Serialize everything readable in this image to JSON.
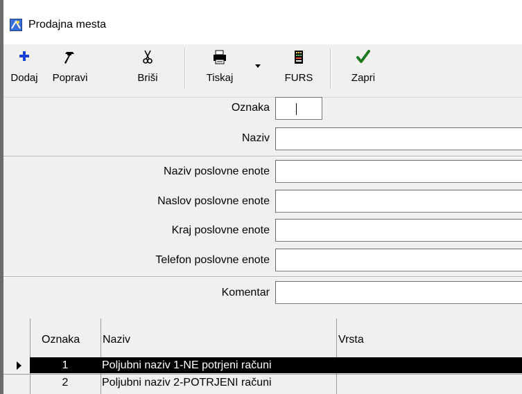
{
  "window": {
    "title": "Prodajna mesta"
  },
  "toolbar": {
    "buttons": [
      {
        "label": "Dodaj",
        "icon": "plus-icon"
      },
      {
        "label": "Popravi",
        "icon": "hammer-icon"
      },
      {
        "label": "Briši",
        "icon": "scissors-icon"
      },
      {
        "label": "Tiskaj",
        "icon": "printer-icon"
      },
      {
        "label": "FURS",
        "icon": "register-icon"
      },
      {
        "label": "Zapri",
        "icon": "checkmark-icon"
      }
    ]
  },
  "form": {
    "oznaka": {
      "label": "Oznaka",
      "value": ""
    },
    "naziv": {
      "label": "Naziv",
      "value": ""
    },
    "naziv_pe": {
      "label": "Naziv poslovne enote",
      "value": ""
    },
    "naslov_pe": {
      "label": "Naslov poslovne enote",
      "value": ""
    },
    "kraj_pe": {
      "label": "Kraj poslovne enote",
      "value": ""
    },
    "telefon_pe": {
      "label": "Telefon poslovne enote",
      "value": ""
    },
    "komentar": {
      "label": "Komentar",
      "value": ""
    }
  },
  "grid": {
    "columns": [
      "Oznaka",
      "Naziv",
      "Vrsta"
    ],
    "rows": [
      {
        "oznaka": "1",
        "naziv": "Poljubni naziv 1-NE potrjeni računi",
        "vrsta": ""
      },
      {
        "oznaka": "2",
        "naziv": "Poljubni naziv 2-POTRJENI računi",
        "vrsta": ""
      }
    ]
  },
  "colors": {
    "selection": "#000000",
    "accent_plus": "#1a3fd6",
    "check": "#1f7a1f"
  }
}
